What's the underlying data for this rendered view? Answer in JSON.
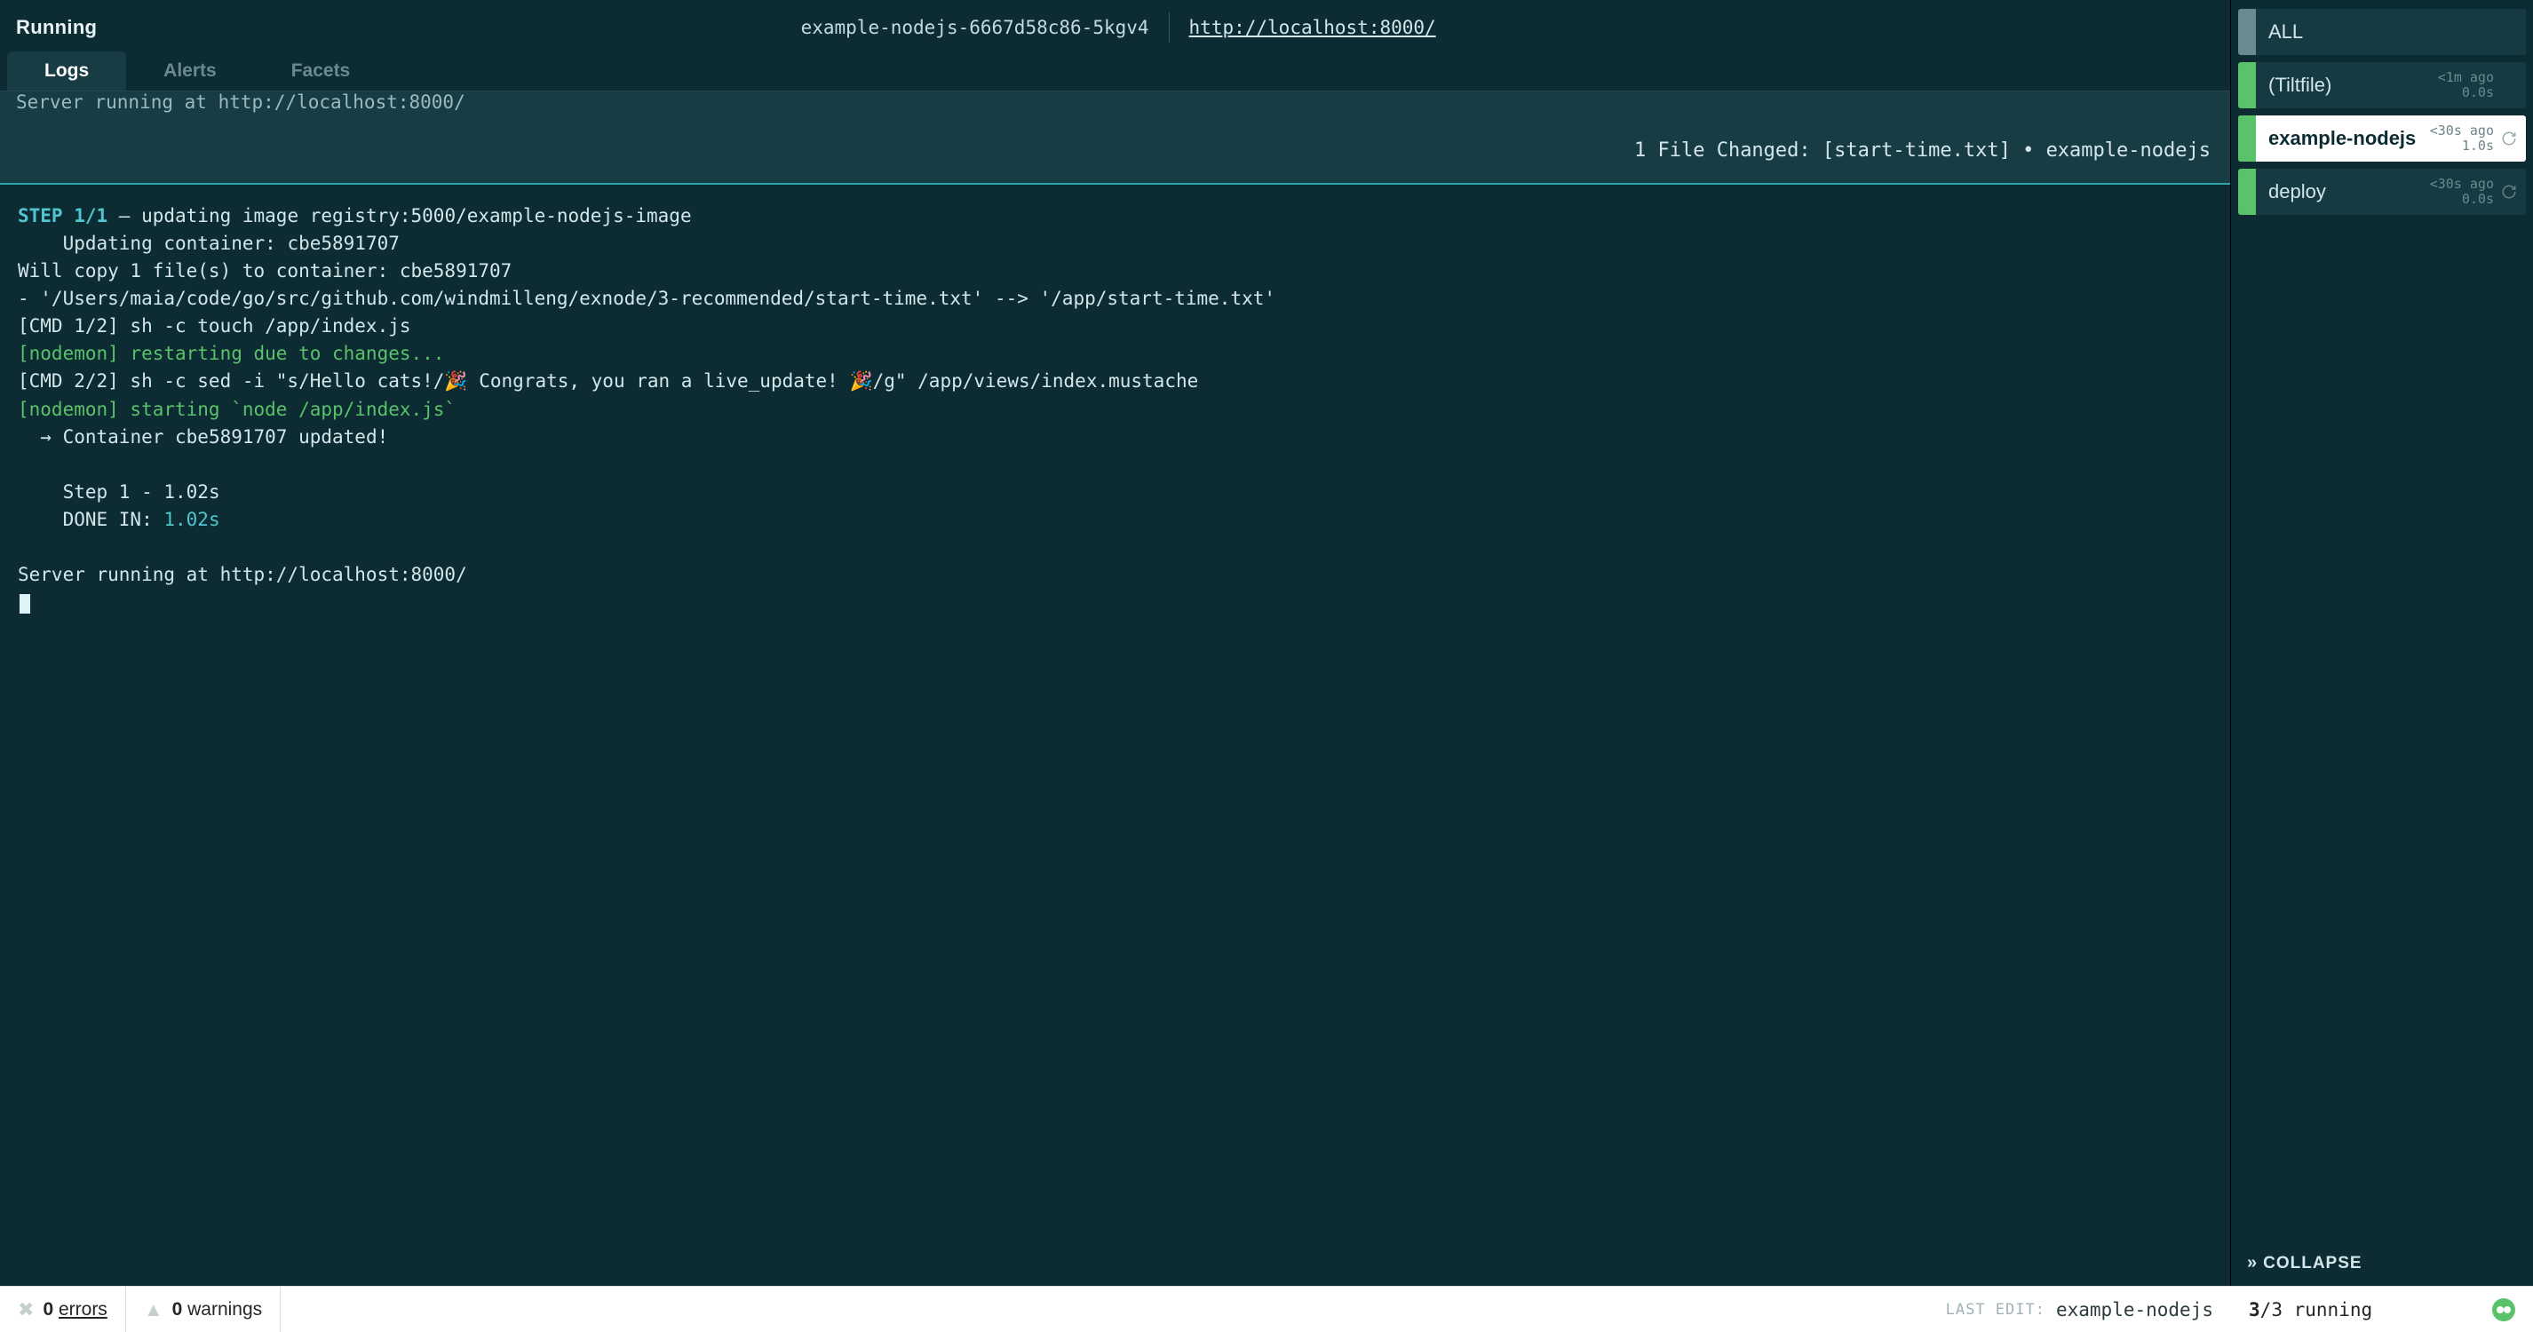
{
  "header": {
    "status": "Running",
    "pod_id": "example-nodejs-6667d58c86-5kgv4",
    "endpoint": "http://localhost:8000/"
  },
  "tabs": [
    {
      "id": "logs",
      "label": "Logs",
      "active": true
    },
    {
      "id": "alerts",
      "label": "Alerts",
      "active": false
    },
    {
      "id": "facets",
      "label": "Facets",
      "active": false
    }
  ],
  "log_preview_trimmed": "Server running at http://localhost:8000/",
  "file_changed_bar": "1 File Changed: [start-time.txt] • example-nodejs",
  "log_lines": [
    {
      "spans": [
        {
          "t": "STEP 1/1",
          "c": "c-cyan"
        },
        {
          "t": " — updating image registry:5000/example-nodejs-image"
        }
      ]
    },
    {
      "spans": [
        {
          "t": "    Updating container: cbe5891707"
        }
      ]
    },
    {
      "spans": [
        {
          "t": "Will copy 1 file(s) to container: cbe5891707"
        }
      ]
    },
    {
      "spans": [
        {
          "t": "- '/Users/maia/code/go/src/github.com/windmilleng/exnode/3-recommended/start-time.txt' --> '/app/start-time.txt'"
        }
      ]
    },
    {
      "spans": [
        {
          "t": "[CMD 1/2] sh -c touch /app/index.js"
        }
      ]
    },
    {
      "spans": [
        {
          "t": "[nodemon] restarting due to changes...",
          "c": "c-green"
        }
      ]
    },
    {
      "spans": [
        {
          "t": "[CMD 2/2] sh -c sed -i \"s/Hello cats!/🎉 Congrats, you ran a live_update! 🎉/g\" /app/views/index.mustache"
        }
      ]
    },
    {
      "spans": [
        {
          "t": "[nodemon] starting `node /app/index.js`",
          "c": "c-green"
        }
      ]
    },
    {
      "spans": [
        {
          "t": "  → Container cbe5891707 updated!"
        }
      ]
    },
    {
      "spans": [
        {
          "t": " "
        }
      ]
    },
    {
      "spans": [
        {
          "t": "    Step 1 - 1.02s"
        }
      ]
    },
    {
      "spans": [
        {
          "t": "    DONE IN: "
        },
        {
          "t": "1.02s",
          "c": "c-teal"
        }
      ]
    },
    {
      "spans": [
        {
          "t": " "
        }
      ]
    },
    {
      "spans": [
        {
          "t": "Server running at http://localhost:8000/"
        }
      ]
    }
  ],
  "sidebar": {
    "items": [
      {
        "label": "ALL",
        "status": "neutral",
        "age": "",
        "dur": "",
        "refresh": false
      },
      {
        "label": "(Tiltfile)",
        "status": "ok",
        "age": "<1m ago",
        "dur": "0.0s",
        "refresh": false
      },
      {
        "label": "example-nodejs",
        "status": "ok",
        "age": "<30s ago",
        "dur": "1.0s",
        "refresh": true,
        "selected": true
      },
      {
        "label": "deploy",
        "status": "ok",
        "age": "<30s ago",
        "dur": "0.0s",
        "refresh": true
      }
    ],
    "collapse_label": "COLLAPSE"
  },
  "footer": {
    "errors_count": "0",
    "errors_label": "errors",
    "warnings_count": "0",
    "warnings_label": "warnings",
    "last_edit_label": "LAST EDIT:",
    "last_edit_value": "example-nodejs",
    "running_done": "3",
    "running_total": "3",
    "running_label": "running"
  }
}
